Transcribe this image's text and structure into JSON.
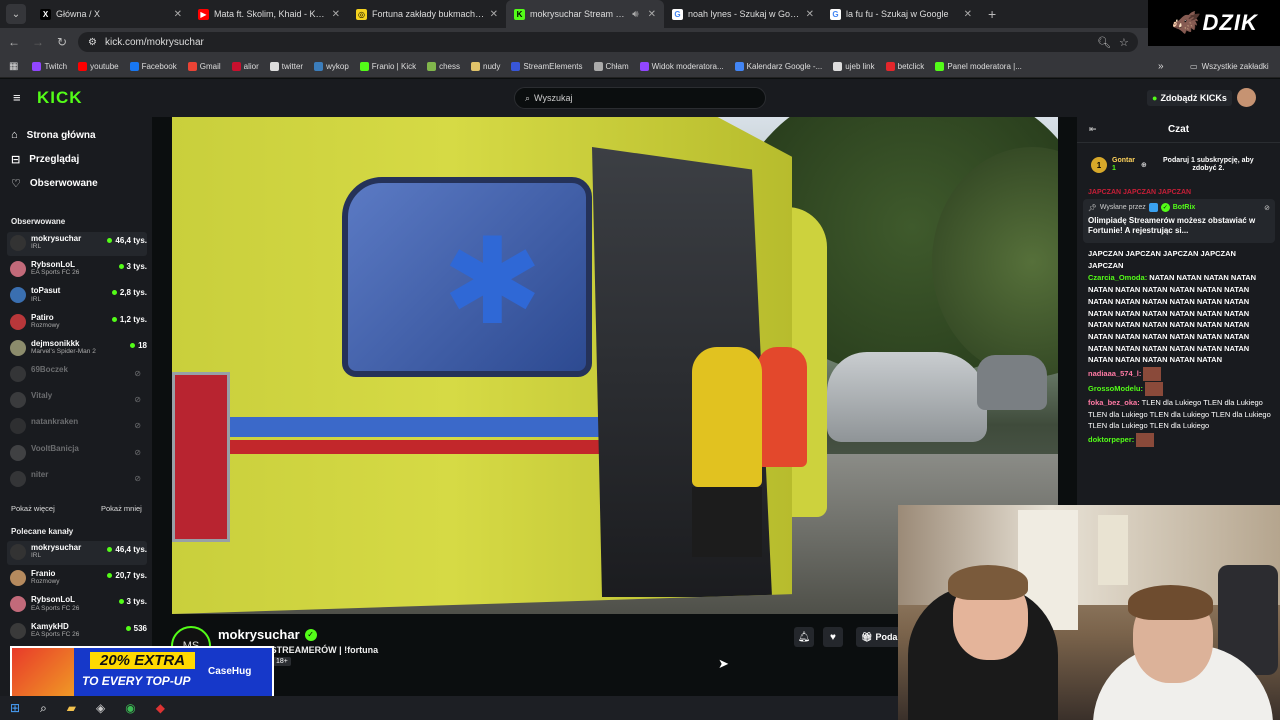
{
  "browser": {
    "tabs": [
      {
        "title": "Główna / X",
        "icon": "x-logo-icon",
        "active": false
      },
      {
        "title": "Mata ft. Skolim, Khaid - KAMIK",
        "icon": "youtube-icon",
        "active": false
      },
      {
        "title": "Fortuna zakłady bukmacherskie",
        "icon": "fortuna-icon",
        "active": false
      },
      {
        "title": "mokrysuchar Stream - Watc",
        "icon": "kick-icon",
        "active": true
      },
      {
        "title": "noah lynes - Szukaj w Google",
        "icon": "google-icon",
        "active": false
      },
      {
        "title": "la fu fu - Szukaj w Google",
        "icon": "google-icon",
        "active": false
      }
    ],
    "url": "kick.com/mokrysuchar",
    "bookmarks": [
      {
        "label": "Twitch",
        "color": "#9146ff"
      },
      {
        "label": "youtube",
        "color": "#ff0000"
      },
      {
        "label": "Facebook",
        "color": "#1877f2"
      },
      {
        "label": "Gmail",
        "color": "#ea4335"
      },
      {
        "label": "alior",
        "color": "#c8102e"
      },
      {
        "label": "twitter",
        "color": "#dddddd"
      },
      {
        "label": "wykop",
        "color": "#3b7dbb"
      },
      {
        "label": "Franio | Kick",
        "color": "#53fc18"
      },
      {
        "label": "chess",
        "color": "#81b64c"
      },
      {
        "label": "nudy",
        "color": "#e0c36a"
      },
      {
        "label": "StreamElements",
        "color": "#3856d8"
      },
      {
        "label": "Chłam",
        "color": "#aaaaaa"
      },
      {
        "label": "Widok moderatora...",
        "color": "#9146ff"
      },
      {
        "label": "Kalendarz Google -...",
        "color": "#4285f4"
      },
      {
        "label": "ujeb link",
        "color": "#dddddd"
      },
      {
        "label": "betclick",
        "color": "#e3262b"
      },
      {
        "label": "Panel moderatora |...",
        "color": "#53fc18"
      }
    ],
    "all_bookmarks": "Wszystkie zakładki"
  },
  "overlay_logo": "DZIK",
  "kick": {
    "logo": "KICK",
    "search_placeholder": "Wyszukaj",
    "kicks_button": "Zdobądź KICKs",
    "nav": [
      {
        "label": "Strona główna",
        "icon": "home-icon"
      },
      {
        "label": "Przeglądaj",
        "icon": "browse-icon"
      },
      {
        "label": "Obserwowane",
        "icon": "heart-icon"
      }
    ],
    "followed_heading": "Obserwowane",
    "followed": [
      {
        "name": "mokrysuchar",
        "category": "IRL",
        "viewers": "46,4 tys.",
        "live": true,
        "color": "#333"
      },
      {
        "name": "RybsonLoL",
        "category": "EA Sports FC 26",
        "viewers": "3 tys.",
        "live": true,
        "color": "#c26a7a"
      },
      {
        "name": "toPasut",
        "category": "IRL",
        "viewers": "2,8 tys.",
        "live": true,
        "color": "#3a6fb0"
      },
      {
        "name": "Patiro",
        "category": "Rozmowy",
        "viewers": "1,2 tys.",
        "live": true,
        "color": "#b8373a"
      },
      {
        "name": "dejmsonikkk",
        "category": "Marvel's Spider-Man 2",
        "viewers": "18",
        "live": true,
        "color": "#8c8c6c"
      },
      {
        "name": "69Boczek",
        "category": "",
        "viewers": "",
        "live": false,
        "color": "#666"
      },
      {
        "name": "Vitaly",
        "category": "",
        "viewers": "",
        "live": false,
        "color": "#777"
      },
      {
        "name": "natankraken",
        "category": "",
        "viewers": "",
        "live": false,
        "color": "#555"
      },
      {
        "name": "VooltBanicja",
        "category": "",
        "viewers": "",
        "live": false,
        "color": "#888"
      },
      {
        "name": "niter",
        "category": "",
        "viewers": "",
        "live": false,
        "color": "#666"
      }
    ],
    "show_more": "Pokaż więcej",
    "show_less": "Pokaż mniej",
    "recommended_heading": "Polecane kanały",
    "recommended": [
      {
        "name": "mokrysuchar",
        "category": "IRL",
        "viewers": "46,4 tys.",
        "color": "#333"
      },
      {
        "name": "Franio",
        "category": "Rozmowy",
        "viewers": "20,7 tys.",
        "color": "#b58a5e"
      },
      {
        "name": "RybsonLoL",
        "category": "EA Sports FC 26",
        "viewers": "3 tys.",
        "color": "#c26a7a"
      },
      {
        "name": "KamykHD",
        "category": "EA Sports FC 26",
        "viewers": "536",
        "color": "#3a3a3a"
      }
    ],
    "streamer": {
      "avatar_text": "MS",
      "name": "mokrysuchar",
      "title": "OLIMPIADA STREAMERÓW | !fortuna",
      "age_badge": "18+",
      "gift_label": "Podar"
    }
  },
  "ad": {
    "headline": "20% EXTRA",
    "subline": "TO EVERY TOP-UP",
    "brand": "CaseHug"
  },
  "chat": {
    "title": "Czat",
    "leader_rank": "1",
    "leader_name": "Gontar",
    "leader_count": "1",
    "leader_prompt": "Podaruj 1 subskrypcję, aby zdobyć 2.",
    "pinned_by_label": "Wysłane przez",
    "pinned_by": "BotRix",
    "pinned_message": "Olimpiadę Streamerów możesz obstawiać w Fortunie! A rejestrując si...",
    "cut_row": "JAPCZAN JAPCZAN JAPCZAN",
    "lines": [
      {
        "user": "",
        "text": "JAPCZAN JAPCZAN JAPCZAN JAPCZAN JAPCZAN"
      },
      {
        "user": "Czarcia_Omoda:",
        "text": "NATAN NATAN NATAN NATAN NATAN NATAN NATAN NATAN NATAN NATAN NATAN NATAN NATAN NATAN NATAN NATAN NATAN NATAN NATAN NATAN NATAN NATAN NATAN NATAN NATAN NATAN NATAN NATAN NATAN NATAN NATAN NATAN NATAN NATAN NATAN NATAN NATAN NATAN NATAN NATAN NATAN NATAN NATAN NATAN NATAN"
      },
      {
        "user": "nadiaaa_574_l:",
        "text": ""
      },
      {
        "user": "GrossoModelu:",
        "text": ""
      },
      {
        "user": "foka_bez_oka:",
        "text": "TLEN dla Lukiego TLEN dla Lukiego TLEN dla Lukiego TLEN dla Lukiego TLEN dla Lukiego TLEN dla Lukiego TLEN dla Lukiego"
      },
      {
        "user": "doktorpeper:",
        "text": ""
      }
    ]
  }
}
